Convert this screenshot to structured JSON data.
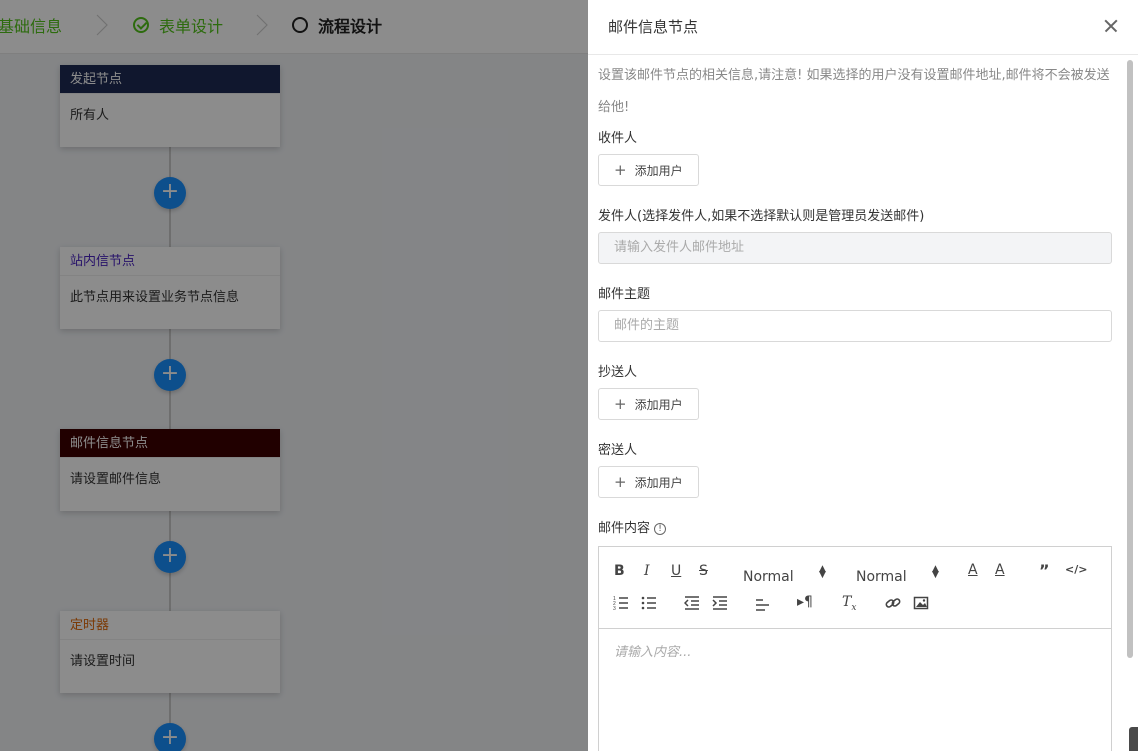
{
  "steps": [
    {
      "label": "基础信息",
      "state": "done"
    },
    {
      "label": "表单设计",
      "state": "done"
    },
    {
      "label": "流程设计",
      "state": "active"
    }
  ],
  "flow_nodes": [
    {
      "title": "发起节点",
      "body": "所有人",
      "head_bg": "#1e2b54",
      "head_color": "#ffffff"
    },
    {
      "title": "站内信节点",
      "body": "此节点用来设置业务节点信息",
      "head_bg": "#ffffff",
      "head_color": "#4a23c2"
    },
    {
      "title": "邮件信息节点",
      "body": "请设置邮件信息",
      "head_bg": "#3d0000",
      "head_color": "#ffffff"
    },
    {
      "title": "定时器",
      "body": "请设置时间",
      "head_bg": "#ffffff",
      "head_color": "#e06a0a"
    }
  ],
  "add_icon": "+",
  "drawer": {
    "title": "邮件信息节点",
    "tip": "设置该邮件节点的相关信息,请注意! 如果选择的用户没有设置邮件地址,邮件将不会被发送给他!",
    "recipient_label": "收件人",
    "add_user_label": "添加用户",
    "sender_label": "发件人(选择发件人,如果不选择默认则是管理员发送邮件)",
    "sender_placeholder": "请输入发件人邮件地址",
    "subject_label": "邮件主题",
    "subject_placeholder": "邮件的主题",
    "cc_label": "抄送人",
    "bcc_label": "密送人",
    "content_label": "邮件内容",
    "editor": {
      "size_picker": "Normal",
      "header_picker": "Normal",
      "placeholder": "请输入内容..."
    }
  },
  "colors": {
    "primary": "#1890ff",
    "success": "#52c41a"
  }
}
